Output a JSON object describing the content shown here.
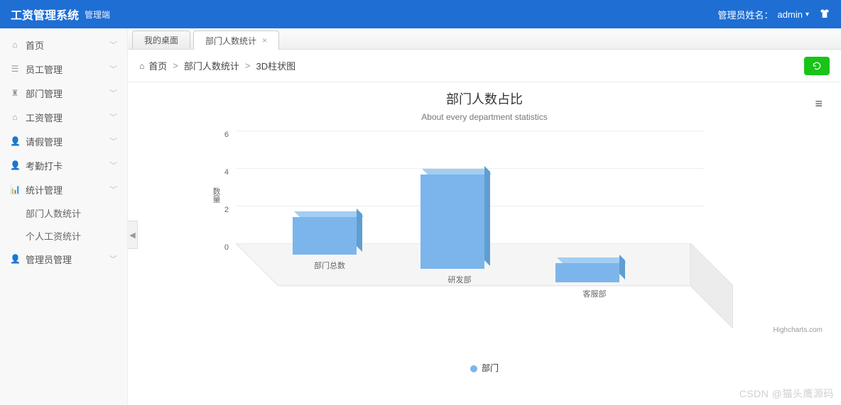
{
  "header": {
    "brand": "工资管理系统",
    "sub": "管理端",
    "admin_label": "管理员姓名：",
    "admin_name": "admin"
  },
  "sidebar": {
    "items": [
      {
        "icon": "home",
        "label": "首页"
      },
      {
        "icon": "user",
        "label": "员工管理"
      },
      {
        "icon": "sitemap",
        "label": "部门管理"
      },
      {
        "icon": "money",
        "label": "工资管理"
      },
      {
        "icon": "calendar",
        "label": "请假管理"
      },
      {
        "icon": "clock",
        "label": "考勤打卡"
      },
      {
        "icon": "chart",
        "label": "统计管理",
        "expanded": true,
        "children": [
          {
            "label": "部门人数统计"
          },
          {
            "label": "个人工资统计"
          }
        ]
      },
      {
        "icon": "admin",
        "label": "管理员管理"
      }
    ]
  },
  "tabs": [
    {
      "label": "我的桌面",
      "closable": false
    },
    {
      "label": "部门人数统计",
      "closable": true,
      "active": true
    }
  ],
  "breadcrumb": [
    "首页",
    "部门人数统计",
    "3D柱状图"
  ],
  "chart_data": {
    "type": "bar",
    "title": "部门人数占比",
    "subtitle": "About every department statistics",
    "ylabel": "数量",
    "ylim": [
      0,
      6
    ],
    "yticks": [
      0,
      2,
      4,
      6
    ],
    "categories": [
      "部门总数",
      "研发部",
      "客服部"
    ],
    "series": [
      {
        "name": "部门",
        "values": [
          2,
          5,
          1
        ]
      }
    ],
    "legend": "部门",
    "credit": "Highcharts.com"
  },
  "watermark": "CSDN @猫头鹰源码"
}
